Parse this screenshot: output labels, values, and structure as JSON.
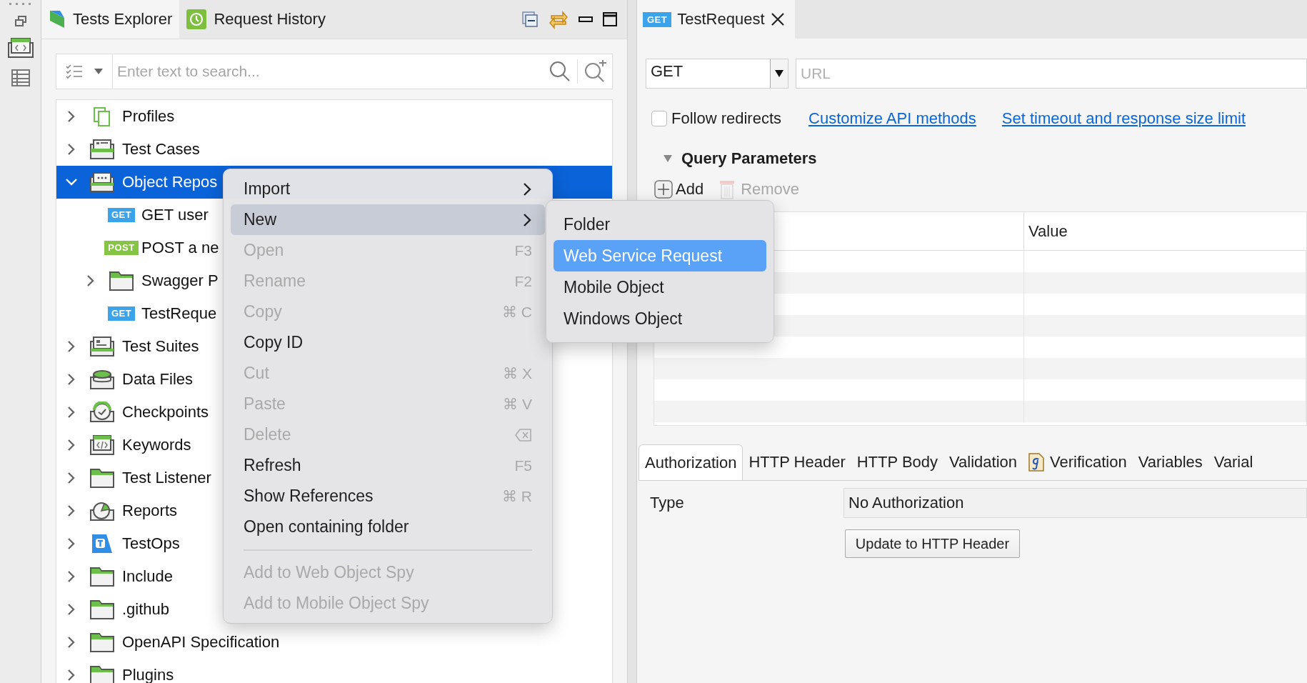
{
  "explorer": {
    "tabs": [
      {
        "label": "Tests Explorer",
        "kind": "explorer",
        "selected": true
      },
      {
        "label": "Request History",
        "kind": "history",
        "selected": false
      }
    ],
    "search": {
      "placeholder": "Enter text to search..."
    },
    "tree": [
      {
        "label": "Profiles",
        "kind": "profiles",
        "expanded": false,
        "selected": false
      },
      {
        "label": "Test Cases",
        "kind": "cases",
        "expanded": false,
        "selected": false
      },
      {
        "label": "Object Repos",
        "kind": "repo",
        "expanded": true,
        "selected": true,
        "children": [
          {
            "label": "GET user",
            "kind": "get",
            "badge": "GET",
            "selected": false
          },
          {
            "label": "POST a ne",
            "kind": "post",
            "badge": "POST",
            "selected": false
          },
          {
            "label": "Swagger P",
            "kind": "folder",
            "expanded": false,
            "selected": false
          },
          {
            "label": "TestReque",
            "kind": "get",
            "badge": "GET",
            "selected": false
          }
        ]
      },
      {
        "label": "Test Suites",
        "kind": "suites",
        "expanded": false,
        "selected": false
      },
      {
        "label": "Data Files",
        "kind": "data",
        "expanded": false,
        "selected": false
      },
      {
        "label": "Checkpoints",
        "kind": "checkpoints",
        "expanded": false,
        "selected": false
      },
      {
        "label": "Keywords",
        "kind": "keywords",
        "expanded": false,
        "selected": false
      },
      {
        "label": "Test Listener",
        "kind": "folder",
        "expanded": false,
        "selected": false
      },
      {
        "label": "Reports",
        "kind": "reports",
        "expanded": false,
        "selected": false
      },
      {
        "label": "TestOps",
        "kind": "testops",
        "expanded": false,
        "selected": false
      },
      {
        "label": "Include",
        "kind": "folder",
        "expanded": false,
        "selected": false
      },
      {
        "label": ".github",
        "kind": "folder",
        "expanded": false,
        "selected": false
      },
      {
        "label": "OpenAPI Specification",
        "kind": "folder",
        "expanded": false,
        "selected": false
      },
      {
        "label": "Plugins",
        "kind": "folder",
        "expanded": false,
        "selected": false
      }
    ]
  },
  "context_menu": {
    "items": [
      {
        "kind": "item",
        "label": "Import",
        "submenu": true,
        "disabled": false,
        "selected": false
      },
      {
        "kind": "item",
        "label": "New",
        "submenu": true,
        "disabled": false,
        "selected": true
      },
      {
        "kind": "item",
        "label": "Open",
        "shortcut": "F3",
        "disabled": true,
        "selected": false
      },
      {
        "kind": "item",
        "label": "Rename",
        "shortcut": "F2",
        "disabled": true,
        "selected": false
      },
      {
        "kind": "item",
        "label": "Copy",
        "shortcut": "⌘ C",
        "disabled": true,
        "selected": false
      },
      {
        "kind": "item",
        "label": "Copy ID",
        "disabled": false,
        "selected": false
      },
      {
        "kind": "item",
        "label": "Cut",
        "shortcut": "⌘ X",
        "disabled": true,
        "selected": false
      },
      {
        "kind": "item",
        "label": "Paste",
        "shortcut": "⌘ V",
        "disabled": true,
        "selected": false
      },
      {
        "kind": "item",
        "label": "Delete",
        "delete_key_icon": true,
        "disabled": true,
        "selected": false
      },
      {
        "kind": "item",
        "label": "Refresh",
        "shortcut": "F5",
        "disabled": false,
        "selected": false
      },
      {
        "kind": "item",
        "label": "Show References",
        "shortcut": "⌘ R",
        "disabled": false,
        "selected": false
      },
      {
        "kind": "item",
        "label": "Open containing folder",
        "disabled": false,
        "selected": false
      },
      {
        "kind": "separator"
      },
      {
        "kind": "item",
        "label": "Add to Web Object Spy",
        "disabled": true,
        "selected": false
      },
      {
        "kind": "item",
        "label": "Add to Mobile Object Spy",
        "disabled": true,
        "selected": false
      }
    ]
  },
  "submenu": {
    "items": [
      {
        "label": "Folder",
        "selected": false
      },
      {
        "label": "Web Service Request",
        "selected": true
      },
      {
        "label": "Mobile Object",
        "selected": false
      },
      {
        "label": "Windows Object",
        "selected": false
      }
    ]
  },
  "editor": {
    "tab": {
      "badge": "GET",
      "label": "TestRequest"
    },
    "method": "GET",
    "url": {
      "placeholder": "URL"
    },
    "follow_redirects": {
      "label": "Follow redirects",
      "checked": false
    },
    "links": [
      "Customize API methods",
      "Set timeout and response size limit"
    ],
    "query_parameters": {
      "title": "Query Parameters",
      "expanded": true,
      "add": "Add",
      "remove": {
        "label": "Remove",
        "disabled": true
      },
      "value_column": "Value"
    },
    "tabs": [
      {
        "label": "Authorization",
        "selected": true
      },
      {
        "label": "HTTP Header",
        "selected": false
      },
      {
        "label": "HTTP Body",
        "selected": false
      },
      {
        "label": "Validation",
        "selected": false
      },
      {
        "label": "Verification",
        "script_icon": true,
        "selected": false
      },
      {
        "label": "Variables",
        "selected": false
      },
      {
        "label": "Varial",
        "selected": false
      }
    ],
    "authorization": {
      "type_label": "Type",
      "type_value": "No Authorization",
      "button": "Update to HTTP Header"
    }
  }
}
